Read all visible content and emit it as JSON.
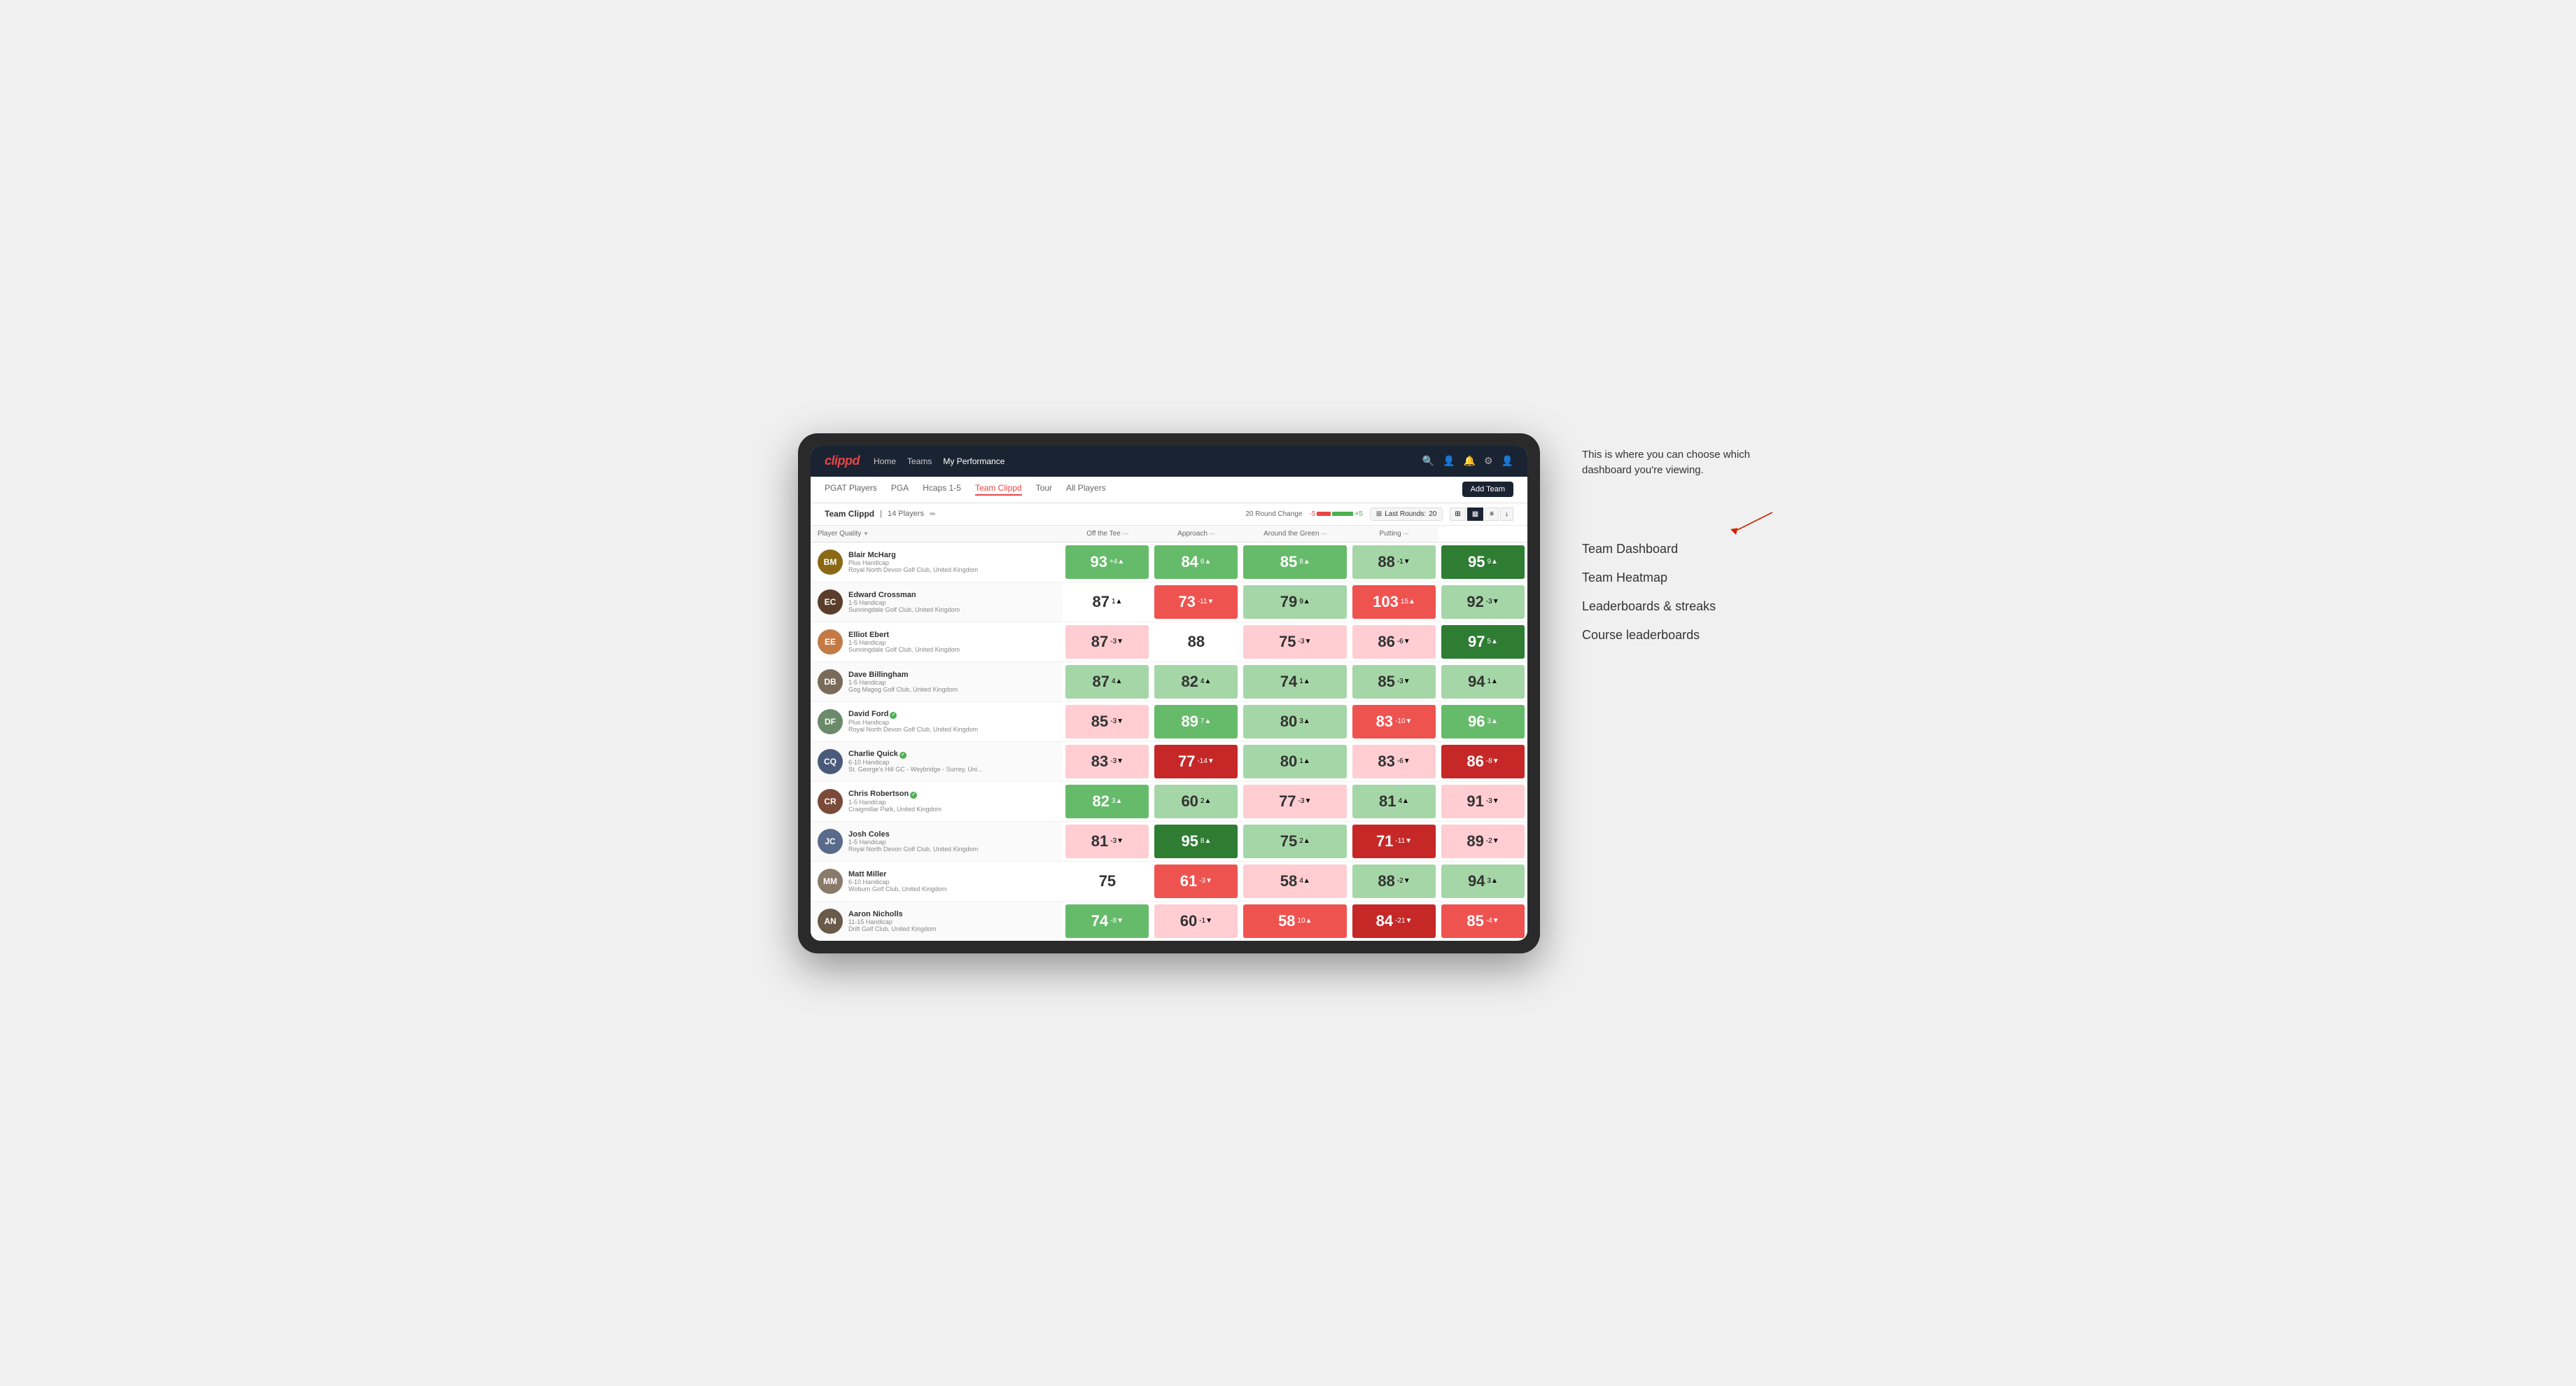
{
  "annotation": {
    "description": "This is where you can choose which dashboard you're viewing.",
    "menu_items": [
      "Team Dashboard",
      "Team Heatmap",
      "Leaderboards & streaks",
      "Course leaderboards"
    ]
  },
  "nav": {
    "logo": "clippd",
    "links": [
      "Home",
      "Teams",
      "My Performance"
    ],
    "active_link": "My Performance"
  },
  "sub_nav": {
    "tabs": [
      "PGAT Players",
      "PGA",
      "Hcaps 1-5",
      "Team Clippd",
      "Tour",
      "All Players"
    ],
    "active_tab": "Team Clippd",
    "add_team_label": "Add Team"
  },
  "team_bar": {
    "team_name": "Team Clippd",
    "separator": "|",
    "player_count": "14 Players",
    "round_change_label": "20 Round Change",
    "change_neg": "-5",
    "change_pos": "+5",
    "last_rounds_label": "Last Rounds:",
    "last_rounds_value": "20"
  },
  "table": {
    "columns": {
      "player": "Player Quality",
      "off_tee": "Off the Tee",
      "approach": "Approach",
      "around_green": "Around the Green",
      "putting": "Putting"
    },
    "rows": [
      {
        "name": "Blair McHarg",
        "handicap": "Plus Handicap",
        "club": "Royal North Devon Golf Club, United Kingdom",
        "initials": "BM",
        "avatar_color": "#8B6914",
        "quality": {
          "score": 93,
          "change": "+4",
          "dir": "up",
          "bg": "bg-green-med"
        },
        "off_tee": {
          "score": 84,
          "change": "6",
          "dir": "up",
          "bg": "bg-green-med"
        },
        "approach": {
          "score": 85,
          "change": "8",
          "dir": "up",
          "bg": "bg-green-med"
        },
        "around_green": {
          "score": 88,
          "change": "-1",
          "dir": "down",
          "bg": "bg-green-light"
        },
        "putting": {
          "score": 95,
          "change": "9",
          "dir": "up",
          "bg": "bg-green-strong"
        }
      },
      {
        "name": "Edward Crossman",
        "handicap": "1-5 Handicap",
        "club": "Sunningdale Golf Club, United Kingdom",
        "initials": "EC",
        "avatar_color": "#5a3e2b",
        "quality": {
          "score": 87,
          "change": "1",
          "dir": "up",
          "bg": "bg-white"
        },
        "off_tee": {
          "score": 73,
          "change": "-11",
          "dir": "down",
          "bg": "bg-red-med"
        },
        "approach": {
          "score": 79,
          "change": "9",
          "dir": "up",
          "bg": "bg-green-light"
        },
        "around_green": {
          "score": 103,
          "change": "15",
          "dir": "up",
          "bg": "bg-red-med"
        },
        "putting": {
          "score": 92,
          "change": "-3",
          "dir": "down",
          "bg": "bg-green-light"
        }
      },
      {
        "name": "Elliot Ebert",
        "handicap": "1-5 Handicap",
        "club": "Sunningdale Golf Club, United Kingdom",
        "initials": "EE",
        "avatar_color": "#c47a45",
        "quality": {
          "score": 87,
          "change": "-3",
          "dir": "down",
          "bg": "bg-red-light"
        },
        "off_tee": {
          "score": 88,
          "change": "",
          "dir": "none",
          "bg": "bg-white"
        },
        "approach": {
          "score": 75,
          "change": "-3",
          "dir": "down",
          "bg": "bg-red-light"
        },
        "around_green": {
          "score": 86,
          "change": "-6",
          "dir": "down",
          "bg": "bg-red-light"
        },
        "putting": {
          "score": 97,
          "change": "5",
          "dir": "up",
          "bg": "bg-green-strong"
        }
      },
      {
        "name": "Dave Billingham",
        "handicap": "1-5 Handicap",
        "club": "Gog Magog Golf Club, United Kingdom",
        "initials": "DB",
        "avatar_color": "#7a6a5a",
        "quality": {
          "score": 87,
          "change": "4",
          "dir": "up",
          "bg": "bg-green-light"
        },
        "off_tee": {
          "score": 82,
          "change": "4",
          "dir": "up",
          "bg": "bg-green-light"
        },
        "approach": {
          "score": 74,
          "change": "1",
          "dir": "up",
          "bg": "bg-green-light"
        },
        "around_green": {
          "score": 85,
          "change": "-3",
          "dir": "down",
          "bg": "bg-green-light"
        },
        "putting": {
          "score": 94,
          "change": "1",
          "dir": "up",
          "bg": "bg-green-light"
        }
      },
      {
        "name": "David Ford",
        "handicap": "Plus Handicap",
        "club": "Royal North Devon Golf Club, United Kingdom",
        "initials": "DF",
        "avatar_color": "#6a8a6a",
        "verified": true,
        "quality": {
          "score": 85,
          "change": "-3",
          "dir": "down",
          "bg": "bg-red-light"
        },
        "off_tee": {
          "score": 89,
          "change": "7",
          "dir": "up",
          "bg": "bg-green-med"
        },
        "approach": {
          "score": 80,
          "change": "3",
          "dir": "up",
          "bg": "bg-green-light"
        },
        "around_green": {
          "score": 83,
          "change": "-10",
          "dir": "down",
          "bg": "bg-red-med"
        },
        "putting": {
          "score": 96,
          "change": "3",
          "dir": "up",
          "bg": "bg-green-med"
        }
      },
      {
        "name": "Charlie Quick",
        "handicap": "6-10 Handicap",
        "club": "St. George's Hill GC - Weybridge - Surrey, Uni...",
        "initials": "CQ",
        "avatar_color": "#4a5a7a",
        "verified": true,
        "quality": {
          "score": 83,
          "change": "-3",
          "dir": "down",
          "bg": "bg-red-light"
        },
        "off_tee": {
          "score": 77,
          "change": "-14",
          "dir": "down",
          "bg": "bg-red-strong"
        },
        "approach": {
          "score": 80,
          "change": "1",
          "dir": "up",
          "bg": "bg-green-light"
        },
        "around_green": {
          "score": 83,
          "change": "-6",
          "dir": "down",
          "bg": "bg-red-light"
        },
        "putting": {
          "score": 86,
          "change": "-8",
          "dir": "down",
          "bg": "bg-red-strong"
        }
      },
      {
        "name": "Chris Robertson",
        "handicap": "1-5 Handicap",
        "club": "Craigmillar Park, United Kingdom",
        "initials": "CR",
        "avatar_color": "#7a4a3a",
        "verified": true,
        "quality": {
          "score": 82,
          "change": "3",
          "dir": "up",
          "bg": "bg-green-med"
        },
        "off_tee": {
          "score": 60,
          "change": "2",
          "dir": "up",
          "bg": "bg-green-light"
        },
        "approach": {
          "score": 77,
          "change": "-3",
          "dir": "down",
          "bg": "bg-red-light"
        },
        "around_green": {
          "score": 81,
          "change": "4",
          "dir": "up",
          "bg": "bg-green-light"
        },
        "putting": {
          "score": 91,
          "change": "-3",
          "dir": "down",
          "bg": "bg-red-light"
        }
      },
      {
        "name": "Josh Coles",
        "handicap": "1-5 Handicap",
        "club": "Royal North Devon Golf Club, United Kingdom",
        "initials": "JC",
        "avatar_color": "#5a6a8a",
        "quality": {
          "score": 81,
          "change": "-3",
          "dir": "down",
          "bg": "bg-red-light"
        },
        "off_tee": {
          "score": 95,
          "change": "8",
          "dir": "up",
          "bg": "bg-green-strong"
        },
        "approach": {
          "score": 75,
          "change": "2",
          "dir": "up",
          "bg": "bg-green-light"
        },
        "around_green": {
          "score": 71,
          "change": "-11",
          "dir": "down",
          "bg": "bg-red-strong"
        },
        "putting": {
          "score": 89,
          "change": "-2",
          "dir": "down",
          "bg": "bg-red-light"
        }
      },
      {
        "name": "Matt Miller",
        "handicap": "6-10 Handicap",
        "club": "Woburn Golf Club, United Kingdom",
        "initials": "MM",
        "avatar_color": "#8a7a6a",
        "quality": {
          "score": 75,
          "change": "",
          "dir": "none",
          "bg": "bg-white"
        },
        "off_tee": {
          "score": 61,
          "change": "-3",
          "dir": "down",
          "bg": "bg-red-med"
        },
        "approach": {
          "score": 58,
          "change": "4",
          "dir": "up",
          "bg": "bg-red-light"
        },
        "around_green": {
          "score": 88,
          "change": "-2",
          "dir": "down",
          "bg": "bg-green-light"
        },
        "putting": {
          "score": 94,
          "change": "3",
          "dir": "up",
          "bg": "bg-green-light"
        }
      },
      {
        "name": "Aaron Nicholls",
        "handicap": "11-15 Handicap",
        "club": "Drift Golf Club, United Kingdom",
        "initials": "AN",
        "avatar_color": "#6a5a4a",
        "quality": {
          "score": 74,
          "change": "-8",
          "dir": "down",
          "bg": "bg-green-med"
        },
        "off_tee": {
          "score": 60,
          "change": "-1",
          "dir": "down",
          "bg": "bg-red-light"
        },
        "approach": {
          "score": 58,
          "change": "10",
          "dir": "up",
          "bg": "bg-red-med"
        },
        "around_green": {
          "score": 84,
          "change": "-21",
          "dir": "down",
          "bg": "bg-red-strong"
        },
        "putting": {
          "score": 85,
          "change": "-4",
          "dir": "down",
          "bg": "bg-red-med"
        }
      }
    ]
  }
}
